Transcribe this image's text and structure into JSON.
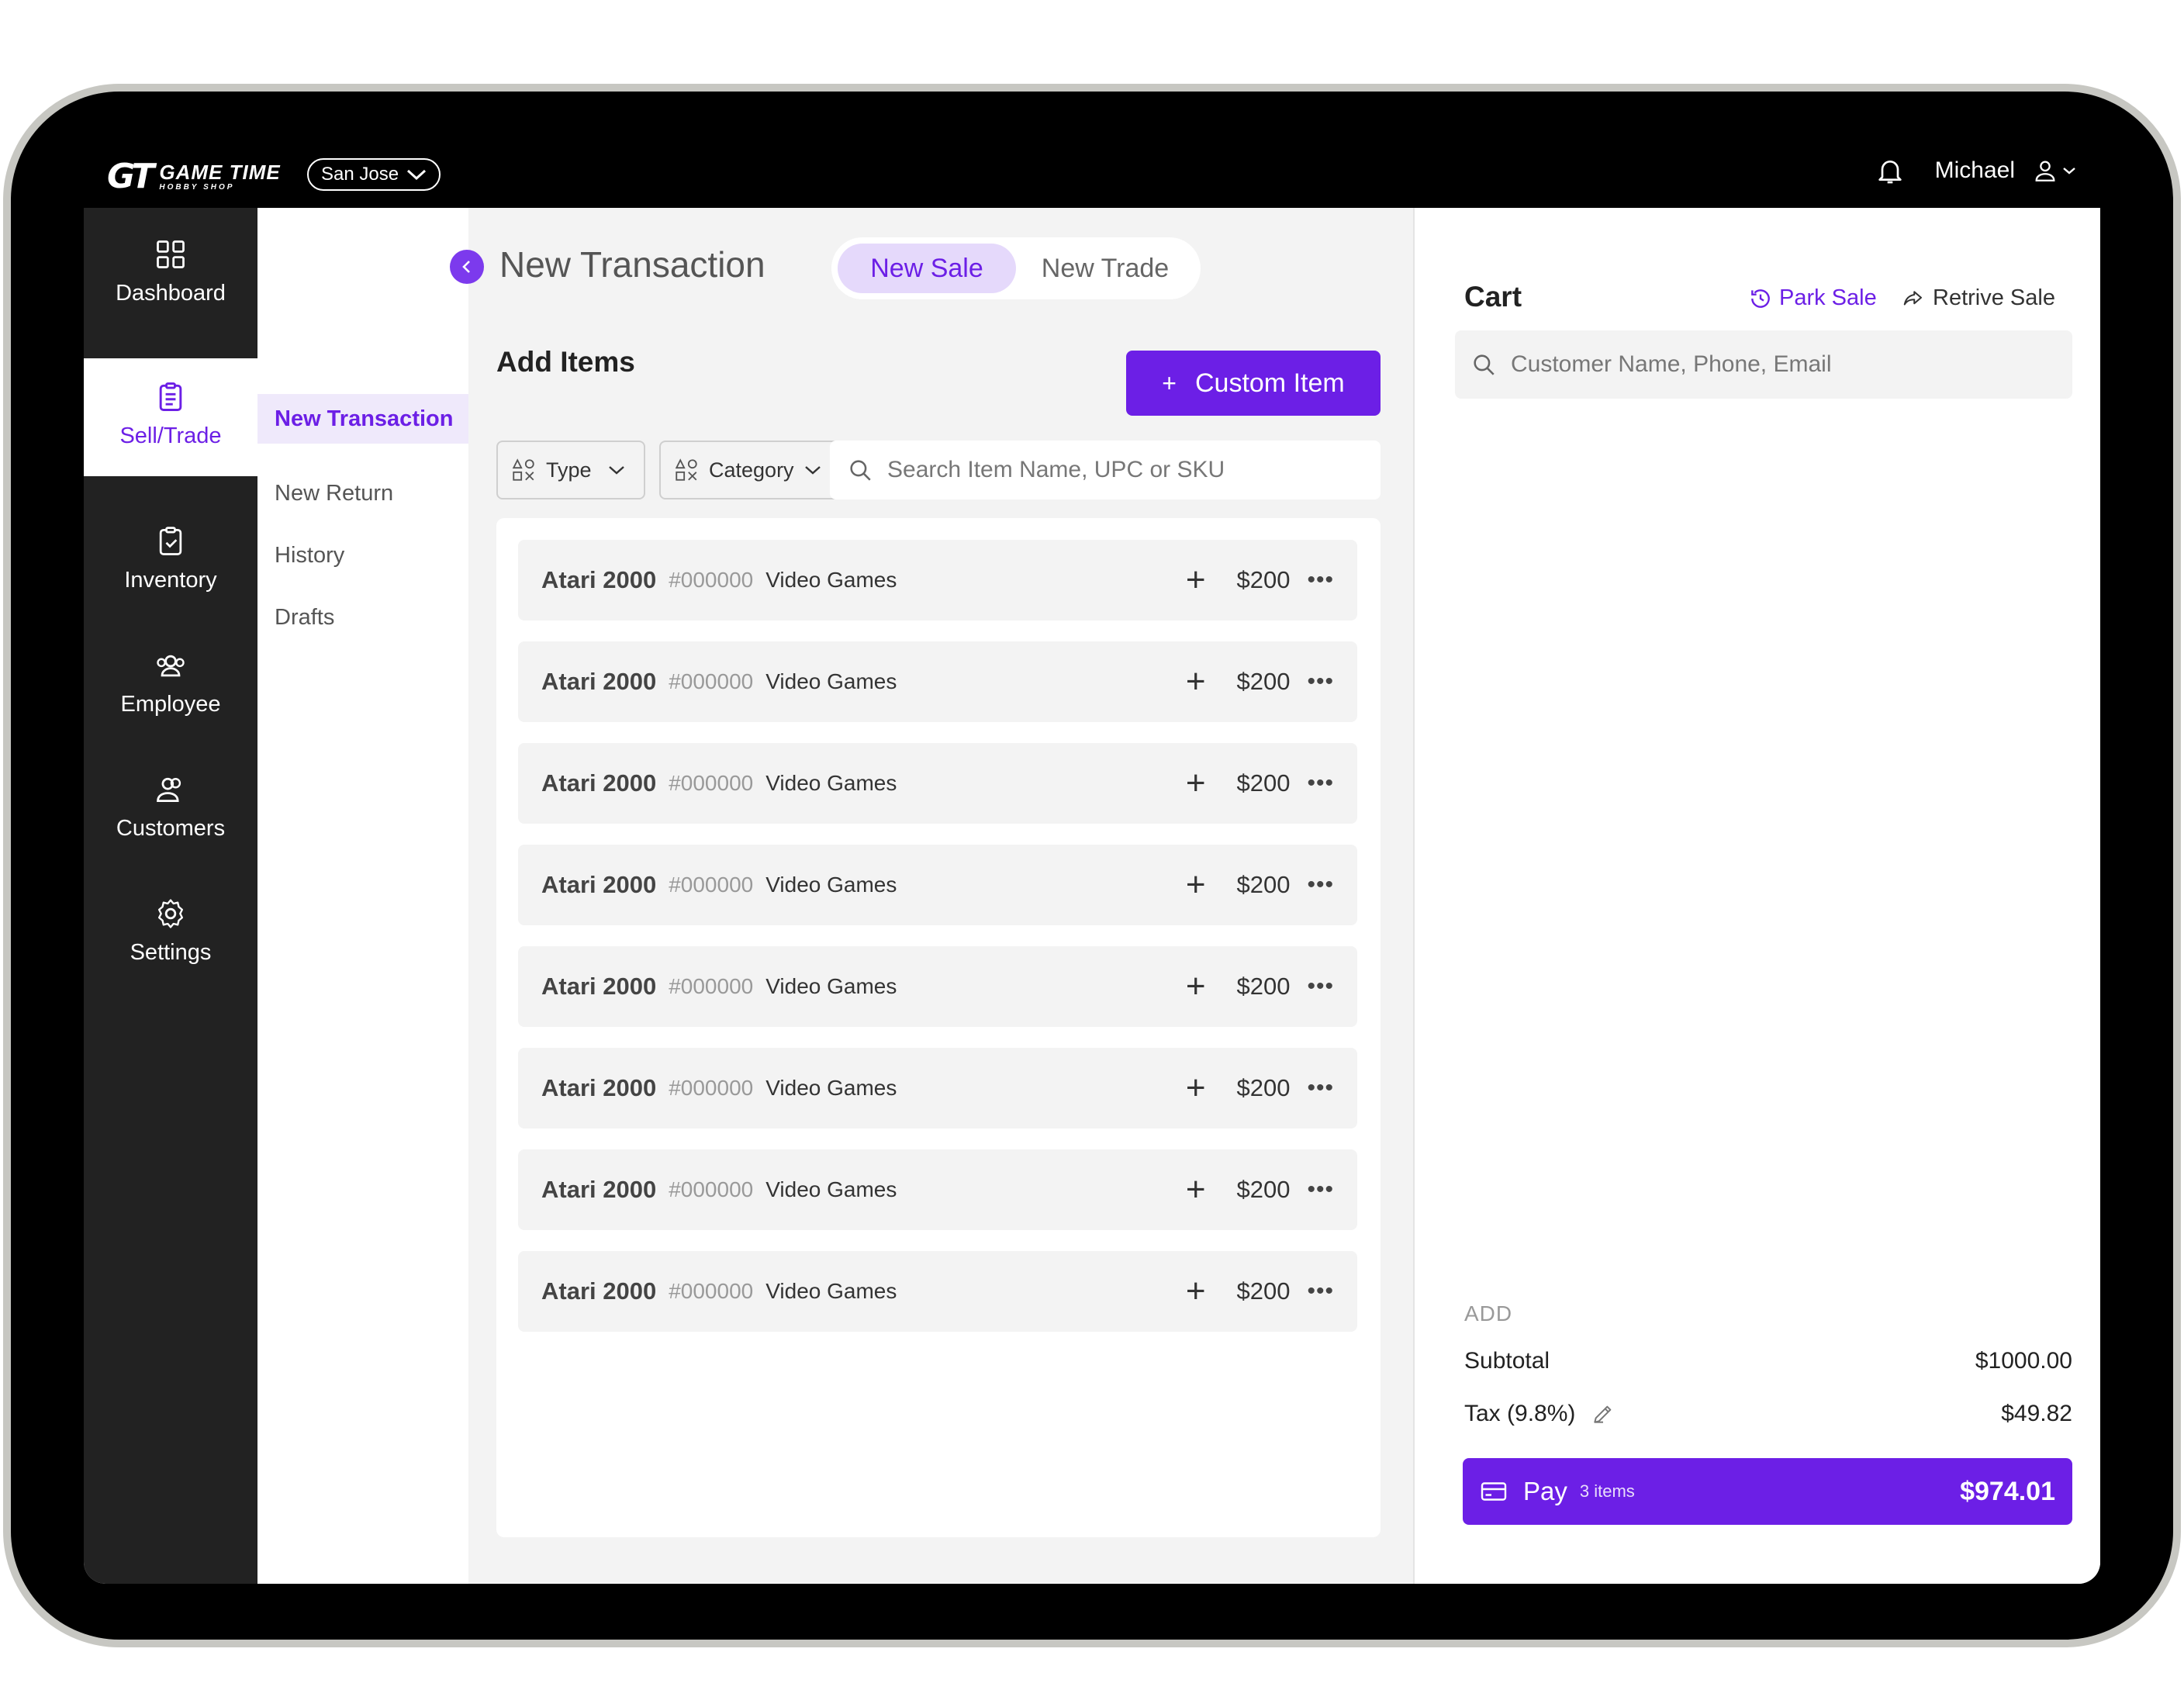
{
  "header": {
    "logo_mark": "GT",
    "logo_title": "GAME TIME",
    "logo_subtitle": "HOBBY SHOP",
    "store": "San Jose",
    "user_name": "Michael"
  },
  "sidebar": {
    "items": [
      {
        "label": "Dashboard",
        "icon": "grid-icon",
        "active": false
      },
      {
        "label": "Sell/Trade",
        "icon": "clipboard-icon",
        "active": true
      },
      {
        "label": "Inventory",
        "icon": "clipboard-check-icon",
        "active": false
      },
      {
        "label": "Employee",
        "icon": "employee-icon",
        "active": false
      },
      {
        "label": "Customers",
        "icon": "users-icon",
        "active": false
      },
      {
        "label": "Settings",
        "icon": "gear-icon",
        "active": false
      }
    ]
  },
  "subnav": {
    "items": [
      {
        "label": "New Transaction",
        "active": true
      },
      {
        "label": "New Return",
        "active": false
      },
      {
        "label": "History",
        "active": false
      },
      {
        "label": "Drafts",
        "active": false
      }
    ]
  },
  "main": {
    "title": "New Transaction",
    "tabs": [
      {
        "label": "New Sale",
        "active": true
      },
      {
        "label": "New Trade",
        "active": false
      }
    ],
    "section_title": "Add Items",
    "custom_item_label": "Custom Item",
    "filters": {
      "type": "Type",
      "category": "Category"
    },
    "search_placeholder": "Search Item Name, UPC or SKU",
    "items": [
      {
        "name": "Atari 2000",
        "sku": "#000000",
        "category": "Video Games",
        "price": "$200"
      },
      {
        "name": "Atari 2000",
        "sku": "#000000",
        "category": "Video Games",
        "price": "$200"
      },
      {
        "name": "Atari 2000",
        "sku": "#000000",
        "category": "Video Games",
        "price": "$200"
      },
      {
        "name": "Atari 2000",
        "sku": "#000000",
        "category": "Video Games",
        "price": "$200"
      },
      {
        "name": "Atari 2000",
        "sku": "#000000",
        "category": "Video Games",
        "price": "$200"
      },
      {
        "name": "Atari 2000",
        "sku": "#000000",
        "category": "Video Games",
        "price": "$200"
      },
      {
        "name": "Atari 2000",
        "sku": "#000000",
        "category": "Video Games",
        "price": "$200"
      },
      {
        "name": "Atari 2000",
        "sku": "#000000",
        "category": "Video Games",
        "price": "$200"
      }
    ]
  },
  "cart": {
    "title": "Cart",
    "park_sale": "Park Sale",
    "retrieve_sale": "Retrive Sale",
    "customer_placeholder": "Customer Name, Phone, Email",
    "add_label": "ADD",
    "subtotal_label": "Subtotal",
    "subtotal_value": "$1000.00",
    "tax_label": "Tax (9.8%)",
    "tax_value": "$49.82",
    "pay_label": "Pay",
    "pay_count": "3 items",
    "pay_total": "$974.01"
  },
  "colors": {
    "accent": "#6c1fe6",
    "accent_light": "#e5d9fb",
    "sidebar_bg": "#222222",
    "bezel": "#000000"
  }
}
